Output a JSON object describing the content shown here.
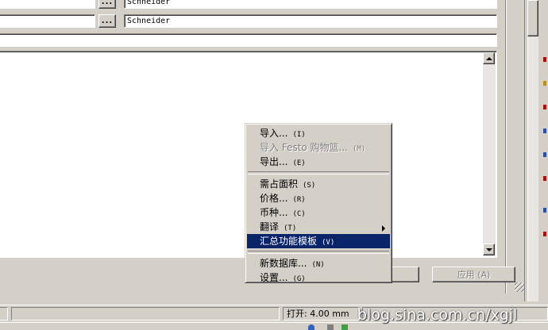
{
  "fields": [
    {
      "button_label": "...",
      "value": "Schneider"
    },
    {
      "button_label": "...",
      "value": "Schneider"
    }
  ],
  "context_menu": {
    "items": [
      {
        "label": "导入...",
        "accel": "(I)",
        "disabled": false
      },
      {
        "label": "导入 Festo 购物篮...",
        "accel": "(M)",
        "disabled": true
      },
      {
        "label": "导出...",
        "accel": "(E)",
        "disabled": false
      },
      {
        "separator": true
      },
      {
        "label": "需占面积",
        "accel": "(S)",
        "disabled": false
      },
      {
        "label": "价格...",
        "accel": "(R)",
        "disabled": false
      },
      {
        "label": "币种...",
        "accel": "(C)",
        "disabled": false
      },
      {
        "label": "翻译",
        "accel": "(T)",
        "disabled": false,
        "submenu": true
      },
      {
        "label": "汇总功能模板",
        "accel": "(V)",
        "disabled": false,
        "highlighted": true
      },
      {
        "separator": true
      },
      {
        "label": "新数据库...",
        "accel": "(N)",
        "disabled": false
      },
      {
        "label": "设置...",
        "accel": "(G)",
        "disabled": false
      }
    ]
  },
  "footer": {
    "apply_label": "应用 (A)"
  },
  "status_bar": {
    "open_label": "打开: 4.00 mm"
  },
  "watermark": "blog.sina.com.cn/xgjl",
  "colors": {
    "face": "#d4d0c8",
    "highlight": "#0a246a"
  }
}
